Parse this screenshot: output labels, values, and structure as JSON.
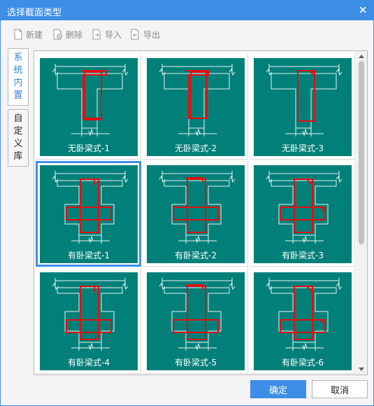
{
  "window": {
    "title": "选择截面类型"
  },
  "toolbar": {
    "new_label": "新建",
    "delete_label": "删除",
    "import_label": "导入",
    "export_label": "导出"
  },
  "sidebar": {
    "tab_builtin": [
      "系",
      "统",
      "内",
      "置"
    ],
    "tab_custom": [
      "自",
      "定",
      "义",
      "库"
    ]
  },
  "gallery": {
    "items": [
      {
        "label": "无卧梁式-1",
        "selected": false
      },
      {
        "label": "无卧梁式-2",
        "selected": false
      },
      {
        "label": "无卧梁式-3",
        "selected": false
      },
      {
        "label": "有卧梁式-1",
        "selected": true
      },
      {
        "label": "有卧梁式-2",
        "selected": false
      },
      {
        "label": "有卧梁式-3",
        "selected": false
      },
      {
        "label": "有卧梁式-4",
        "selected": false
      },
      {
        "label": "有卧梁式-5",
        "selected": false
      },
      {
        "label": "有卧梁式-6",
        "selected": false
      }
    ]
  },
  "footer": {
    "ok_label": "确定",
    "cancel_label": "取消"
  },
  "colors": {
    "accent": "#3d8ee6",
    "thumb_bg": "#008079",
    "rebar": "#e01010"
  }
}
